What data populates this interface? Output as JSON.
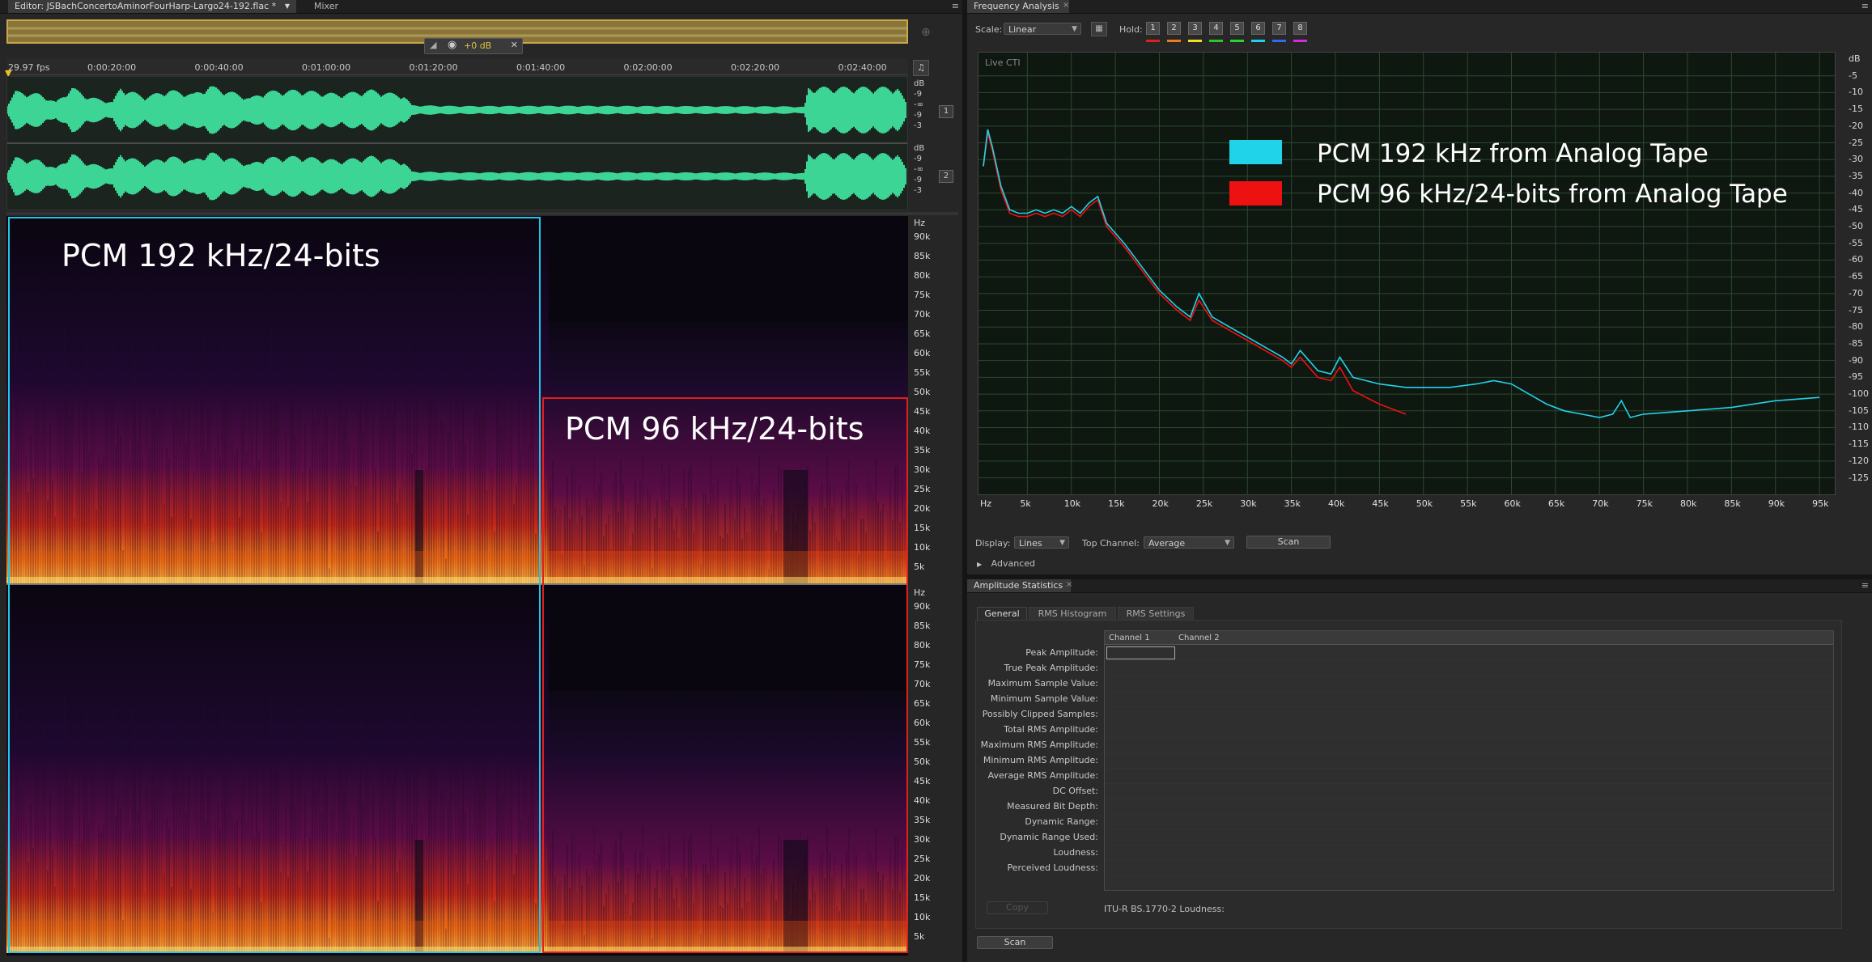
{
  "editor": {
    "tab_title": "Editor: JSBachConcertoAminorFourHarp-Largo24-192.flac *",
    "mixer_tab": "Mixer",
    "gain_value": "+0 dB",
    "fps": "29.97 fps",
    "time_ruler": [
      "0:00:20:00",
      "0:00:40:00",
      "0:01:00:00",
      "0:01:20:00",
      "0:01:40:00",
      "0:02:00:00",
      "0:02:20:00",
      "0:02:40:00"
    ],
    "waveform_db_labels": [
      "dB",
      "-9",
      "-∞",
      "-9",
      "-3"
    ],
    "channel_1": "1",
    "channel_2": "2",
    "spectrum_hz_unit": "Hz",
    "spectrum_hz_labels": [
      "90k",
      "85k",
      "80k",
      "75k",
      "70k",
      "65k",
      "60k",
      "55k",
      "50k",
      "45k",
      "40k",
      "35k",
      "30k",
      "25k",
      "20k",
      "15k",
      "10k",
      "5k"
    ],
    "annotation_192": "PCM 192 kHz/24-bits",
    "annotation_96": "PCM 96 kHz/24-bits",
    "colors": {
      "waveform": "#3dd595",
      "box_192": "#1ec8e6",
      "box_96": "#e0201c"
    }
  },
  "frequency_analysis": {
    "tab_title": "Frequency Analysis",
    "scale_label": "Scale:",
    "scale_value": "Linear",
    "hold_label": "Hold:",
    "hold_buttons": [
      "1",
      "2",
      "3",
      "4",
      "5",
      "6",
      "7",
      "8"
    ],
    "hold_colors": [
      "#e02020",
      "#f07b1d",
      "#f0e020",
      "#28c828",
      "#2ad62a",
      "#20d0f0",
      "#2e6cf0",
      "#d828d8"
    ],
    "live_cti": "Live CTI",
    "legend": [
      {
        "label": "PCM 192 kHz from Analog Tape",
        "color": "#21d3e8"
      },
      {
        "label": "PCM 96 kHz/24-bits from Analog Tape",
        "color": "#ee1111"
      }
    ],
    "db_axis": [
      "dB",
      "-5",
      "-10",
      "-15",
      "-20",
      "-25",
      "-30",
      "-35",
      "-40",
      "-45",
      "-50",
      "-55",
      "-60",
      "-65",
      "-70",
      "-75",
      "-80",
      "-85",
      "-90",
      "-95",
      "-100",
      "-105",
      "-110",
      "-115",
      "-120",
      "-125"
    ],
    "hz_axis": [
      "Hz",
      "5k",
      "10k",
      "15k",
      "20k",
      "25k",
      "30k",
      "35k",
      "40k",
      "45k",
      "50k",
      "55k",
      "60k",
      "65k",
      "70k",
      "75k",
      "80k",
      "85k",
      "90k",
      "95k"
    ],
    "display_label": "Display:",
    "display_value": "Lines",
    "top_channel_label": "Top Channel:",
    "top_channel_value": "Average",
    "scan_button": "Scan",
    "advanced_label": "Advanced"
  },
  "amplitude_statistics": {
    "tab_title": "Amplitude Statistics",
    "subtabs": [
      "General",
      "RMS Histogram",
      "RMS Settings"
    ],
    "columns": [
      "Channel 1",
      "Channel 2"
    ],
    "rows": [
      "Peak Amplitude:",
      "True Peak Amplitude:",
      "Maximum Sample Value:",
      "Minimum Sample Value:",
      "Possibly Clipped Samples:",
      "Total RMS Amplitude:",
      "Maximum RMS Amplitude:",
      "Minimum RMS Amplitude:",
      "Average RMS Amplitude:",
      "DC Offset:",
      "Measured Bit Depth:",
      "Dynamic Range:",
      "Dynamic Range Used:",
      "Loudness:",
      "Perceived Loudness:"
    ],
    "copy_button": "Copy",
    "itu_label": "ITU-R BS.1770-2 Loudness:",
    "scan_button": "Scan"
  },
  "chart_data": {
    "type": "line",
    "xlabel": "Hz",
    "ylabel": "dB",
    "xlim": [
      0,
      96000
    ],
    "ylim": [
      -128,
      0
    ],
    "series": [
      {
        "name": "PCM 192 kHz from Analog Tape",
        "x": [
          0,
          500,
          1000,
          2000,
          3000,
          4000,
          5000,
          6000,
          7000,
          8000,
          9000,
          10000,
          11000,
          12000,
          13000,
          14000,
          16000,
          18000,
          20000,
          22000,
          23500,
          24500,
          26000,
          28000,
          30000,
          32000,
          34000,
          35000,
          36000,
          38000,
          39500,
          40500,
          42000,
          45000,
          48000,
          50000,
          53000,
          56000,
          58000,
          60000,
          62000,
          64000,
          66000,
          68000,
          70000,
          71500,
          72500,
          73500,
          75000,
          80000,
          85000,
          90000,
          95000
        ],
        "y": [
          -32,
          -21,
          -26,
          -38,
          -45,
          -46,
          -46,
          -45,
          -46,
          -45,
          -46,
          -44,
          -46,
          -43,
          -41,
          -49,
          -55,
          -62,
          -69,
          -74,
          -77,
          -70,
          -77,
          -80,
          -83,
          -86,
          -89,
          -91,
          -87,
          -93,
          -94,
          -89,
          -95,
          -97,
          -98,
          -98,
          -98,
          -97,
          -96,
          -97,
          -100,
          -103,
          -105,
          -106,
          -107,
          -106,
          -102,
          -107,
          -106,
          -105,
          -104,
          -102,
          -101
        ]
      },
      {
        "name": "PCM 96 kHz/24-bits from Analog Tape",
        "x": [
          0,
          500,
          1000,
          2000,
          3000,
          4000,
          5000,
          6000,
          7000,
          8000,
          9000,
          10000,
          11000,
          12000,
          13000,
          14000,
          16000,
          18000,
          20000,
          22000,
          23500,
          24500,
          26000,
          28000,
          30000,
          32000,
          34000,
          35000,
          36000,
          38000,
          39500,
          40500,
          42000,
          45000,
          48000
        ],
        "y": [
          -32,
          -22,
          -27,
          -39,
          -46,
          -47,
          -47,
          -46,
          -47,
          -46,
          -47,
          -45,
          -47,
          -44,
          -42,
          -50,
          -56,
          -63,
          -70,
          -75,
          -78,
          -72,
          -78,
          -81,
          -84,
          -87,
          -90,
          -92,
          -89,
          -95,
          -96,
          -92,
          -99,
          -103,
          -106
        ]
      }
    ]
  }
}
